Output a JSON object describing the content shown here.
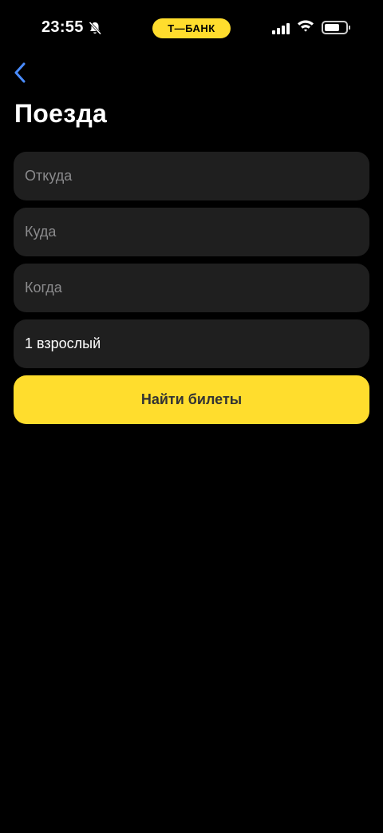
{
  "status_bar": {
    "time": "23:55",
    "bell_icon": "bell-slash-icon",
    "brand": "Т—БАНК",
    "brand_color": "#ffdd2d",
    "signal_icon": "cellular-signal-icon",
    "wifi_icon": "wifi-icon",
    "battery_icon": "battery-icon",
    "battery_level": 0.7
  },
  "nav": {
    "back_icon": "chevron-left-icon",
    "accent_color": "#4a8cff"
  },
  "page": {
    "title": "Поезда"
  },
  "form": {
    "from_placeholder": "Откуда",
    "to_placeholder": "Куда",
    "date_placeholder": "Когда",
    "passengers_value": "1 взрослый",
    "search_label": "Найти билеты",
    "field_bg": "#1f1f1f",
    "button_color": "#ffdd2d"
  }
}
